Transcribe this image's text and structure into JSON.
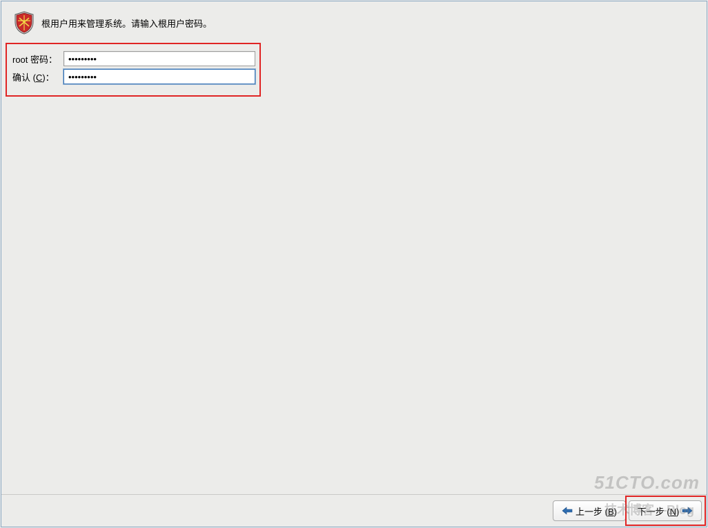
{
  "instruction": "根用户用来管理系统。请输入根用户密码。",
  "form": {
    "root_label": "root 密码：",
    "root_value": "•••••••••",
    "confirm_label_pre": "确认 (",
    "confirm_label_key": "C",
    "confirm_label_post": ")：",
    "confirm_value": "•••••••••"
  },
  "footer": {
    "back_pre": "上一步 (",
    "back_key": "B",
    "back_post": ")",
    "next_pre": "下一步 (",
    "next_key": "N",
    "next_post": ")"
  },
  "watermark": {
    "line1": "51CTO.com",
    "line2": "技术博客—Blog"
  },
  "colors": {
    "highlight_border": "#e02424",
    "window_border": "#89a6c2"
  }
}
